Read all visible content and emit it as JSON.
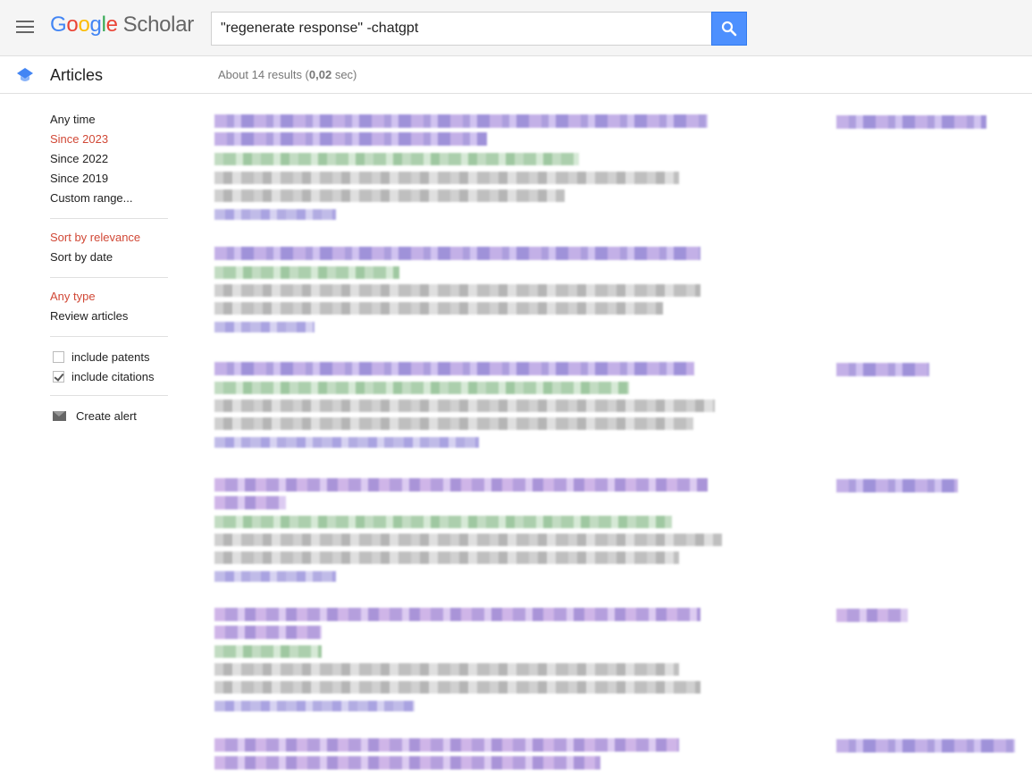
{
  "header": {
    "menu_icon": "hamburger-menu-icon",
    "logo": {
      "google_letters": [
        "G",
        "o",
        "o",
        "g",
        "l",
        "e"
      ],
      "product": "Scholar"
    },
    "search": {
      "query": "\"regenerate response\" -chatgpt",
      "button_icon": "search-icon"
    }
  },
  "subheader": {
    "icon": "graduation-cap-icon",
    "title": "Articles",
    "results_prefix": "About 14 results (",
    "results_time": "0,02",
    "results_suffix": " sec)"
  },
  "sidebar": {
    "time_filters": [
      {
        "label": "Any time",
        "active": false
      },
      {
        "label": "Since 2023",
        "active": true
      },
      {
        "label": "Since 2022",
        "active": false
      },
      {
        "label": "Since 2019",
        "active": false
      },
      {
        "label": "Custom range...",
        "active": false
      }
    ],
    "sort_options": [
      {
        "label": "Sort by relevance",
        "active": true
      },
      {
        "label": "Sort by date",
        "active": false
      }
    ],
    "type_filters": [
      {
        "label": "Any type",
        "active": true
      },
      {
        "label": "Review articles",
        "active": false
      }
    ],
    "checkboxes": [
      {
        "label": "include patents",
        "checked": false
      },
      {
        "label": "include citations",
        "checked": true
      }
    ],
    "create_alert": {
      "label": "Create alert",
      "icon": "mail-icon"
    }
  },
  "colors": {
    "active_filter": "#d14836",
    "search_button": "#4d90fe",
    "header_bg": "#f5f5f5"
  }
}
